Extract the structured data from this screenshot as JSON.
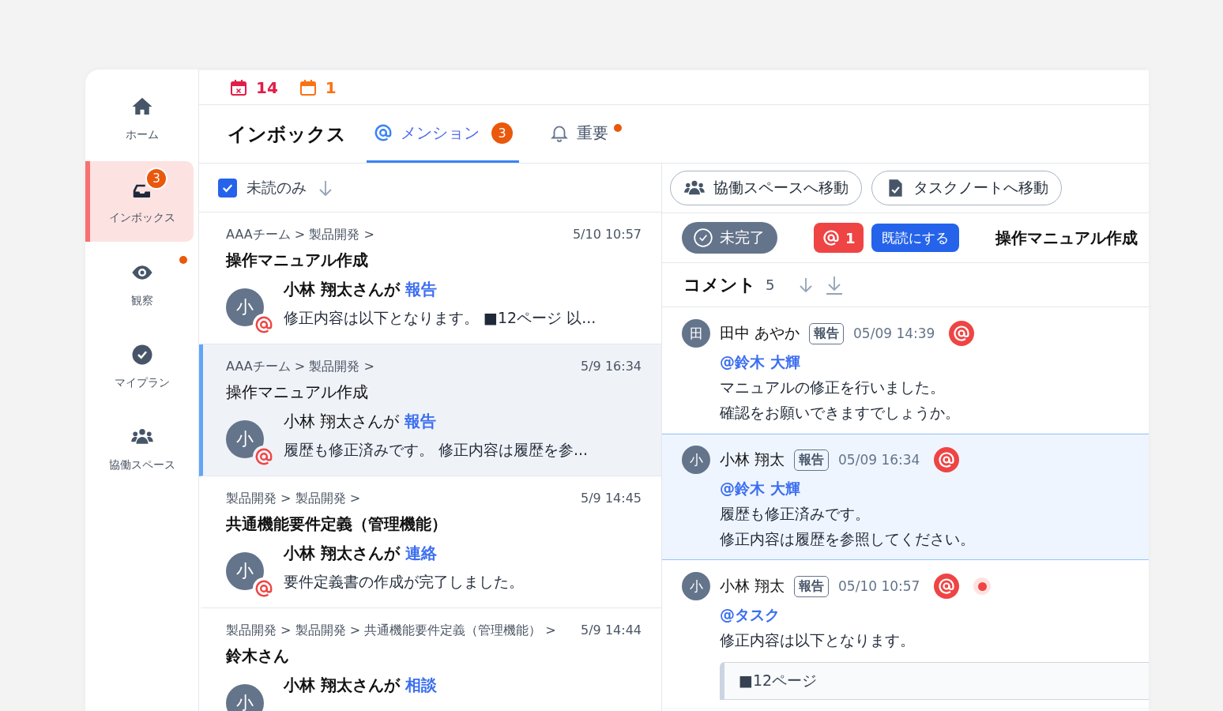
{
  "top_counts": [
    {
      "kind": "overdue",
      "count": "14"
    },
    {
      "kind": "today",
      "count": "1"
    }
  ],
  "sidebar": {
    "items": [
      {
        "label": "ホーム",
        "kind": "home",
        "selected": false,
        "dot": false
      },
      {
        "label": "インボックス",
        "kind": "inbox",
        "selected": true,
        "badge": "3",
        "dot": false
      },
      {
        "label": "観察",
        "kind": "watch",
        "selected": false,
        "dot": true
      },
      {
        "label": "マイプラン",
        "kind": "plan",
        "selected": false,
        "dot": false
      },
      {
        "label": "協働スペース",
        "kind": "space",
        "selected": false,
        "dot": false
      }
    ]
  },
  "header": {
    "title": "インボックス",
    "tabs": [
      {
        "label": "メンション",
        "kind": "mention",
        "selected": true,
        "badge": "3",
        "dot": false
      },
      {
        "label": "重要",
        "kind": "important",
        "selected": false,
        "dot": true
      }
    ]
  },
  "list": {
    "filter": {
      "label": "未読のみ",
      "checked": true
    },
    "items": [
      {
        "path": "AAAチーム > 製品開発 >",
        "time": "5/10 10:57",
        "title": "操作マニュアル作成",
        "unread": true,
        "selected": false,
        "avatar": "小",
        "author": "小林 翔太さんが",
        "action": "報告",
        "preview": "修正内容は以下となります。 ■12ページ 以..."
      },
      {
        "path": "AAAチーム > 製品開発 >",
        "time": "5/9 16:34",
        "title": "操作マニュアル作成",
        "unread": false,
        "selected": true,
        "avatar": "小",
        "author": "小林 翔太さんが",
        "action": "報告",
        "preview": "履歴も修正済みです。 修正内容は履歴を参..."
      },
      {
        "path": "製品開発 > 製品開発 >",
        "time": "5/9 14:45",
        "title": "共通機能要件定義（管理機能）",
        "unread": true,
        "selected": false,
        "avatar": "小",
        "author": "小林 翔太さんが",
        "action": "連絡",
        "preview": "要件定義書の作成が完了しました。"
      },
      {
        "path": "製品開発 > 製品開発 > 共通機能要件定義（管理機能） >",
        "time": "5/9 14:44",
        "title": "鈴木さん",
        "unread": true,
        "selected": false,
        "avatar": "小",
        "author": "小林 翔太さんが",
        "action": "相談"
      }
    ]
  },
  "detail": {
    "actions": [
      {
        "label": "協働スペースへ移動",
        "kind": "space"
      },
      {
        "label": "タスクノートへ移動",
        "kind": "note"
      }
    ],
    "status": {
      "label": "未完了",
      "done": false
    },
    "mentions": "1",
    "mark_read": "既読にする",
    "title": "操作マニュアル作成",
    "comments": {
      "title": "コメント",
      "count": "5",
      "items": [
        {
          "avatar": "田",
          "name": "田中 あやか",
          "tag": "報告",
          "time": "05/09 14:39",
          "unread": false,
          "selected": false,
          "mention": "@鈴木 大輝",
          "lines": [
            "マニュアルの修正を行いました。",
            "確認をお願いできますでしょうか。"
          ]
        },
        {
          "avatar": "小",
          "name": "小林 翔太",
          "tag": "報告",
          "time": "05/09 16:34",
          "unread": false,
          "selected": true,
          "mention": "@鈴木 大輝",
          "lines": [
            "履歴も修正済みです。",
            "修正内容は履歴を参照してください。"
          ]
        },
        {
          "avatar": "小",
          "name": "小林 翔太",
          "tag": "報告",
          "time": "05/10 10:57",
          "unread": true,
          "selected": false,
          "mention": "@タスク",
          "lines": [
            "修正内容は以下となります。"
          ],
          "quote": "■12ページ"
        }
      ]
    }
  }
}
